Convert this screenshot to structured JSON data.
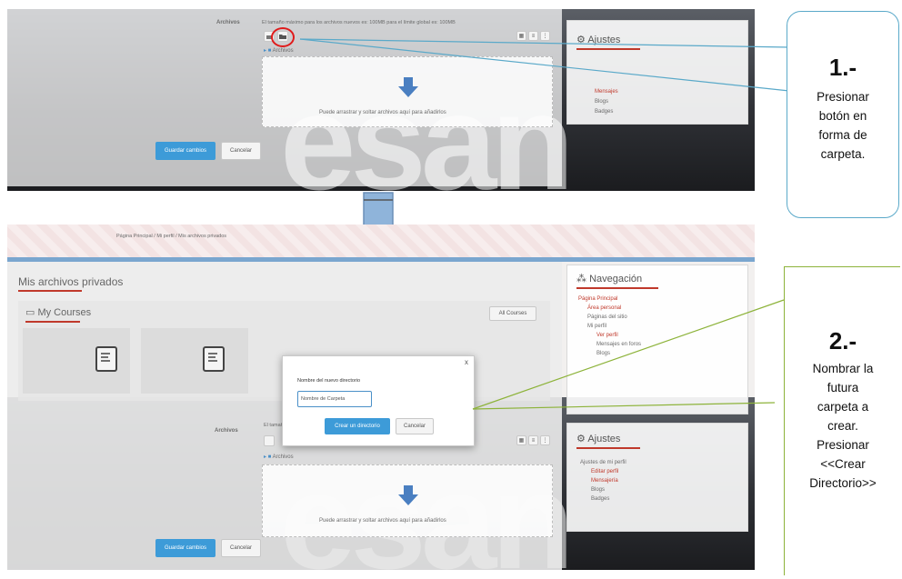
{
  "top_shot": {
    "file_label": "Archivos",
    "limit_text": "El tamaño máximo para los archivos nuevos es: 100MB para el límite global es: 100MB",
    "tree_label": "Archivos",
    "drop_text": "Puede arrastrar y soltar archivos aquí para añadirlos",
    "save_button": "Guardar cambios",
    "cancel_button": "Cancelar",
    "settings_title": "Ajustes",
    "settings_items": [
      "Mensajes",
      "Blogs",
      "Badges"
    ]
  },
  "bottom_shot": {
    "breadcrumb": "Página Principal / Mi perfil / Mis archivos privados",
    "page_title": "Mis archivos privados",
    "courses_title": "My Courses",
    "all_courses_button": "All Courses",
    "file_label": "Archivos",
    "limit_text": "El tamaño máximo para los archivos nuevos es: 100MB para el límite global es: 100MB",
    "tree_label": "Archivos",
    "drop_text": "Puede arrastrar y soltar archivos aquí para añadirlos",
    "save_button": "Guardar cambios",
    "cancel_button": "Cancelar",
    "navigation_title": "Navegación",
    "navigation_items": [
      "Página Principal",
      "Área personal",
      "Páginas del sitio",
      "Mi perfil",
      "Ver perfil",
      "Mensajes en foros",
      "Blogs"
    ],
    "settings_title": "Ajustes",
    "settings_items": [
      "Ajustes de mi perfil",
      "Editar perfil",
      "Mensajería",
      "Blogs",
      "Badges"
    ],
    "dialog": {
      "label": "Nombre del nuevo directorio",
      "input_value": "Nombre de Carpeta",
      "create_button": "Crear un directorio",
      "cancel_button": "Cancelar",
      "close": "x"
    }
  },
  "callout_1": {
    "number": "1.-",
    "lines": [
      "Presionar",
      "botón en",
      "forma de",
      "carpeta."
    ]
  },
  "callout_2": {
    "number": "2.-",
    "lines": [
      "Nombrar la",
      "futura",
      "carpeta a",
      "crear.",
      "Presionar",
      "<<Crear",
      "Directorio>>"
    ]
  },
  "colors": {
    "callout_1_border": "#5aa9c9",
    "callout_2_border": "#8db33a",
    "highlight_red": "#e01b1b",
    "primary_button": "#3d9bd8",
    "arrow_fill": "#8fb4da"
  }
}
